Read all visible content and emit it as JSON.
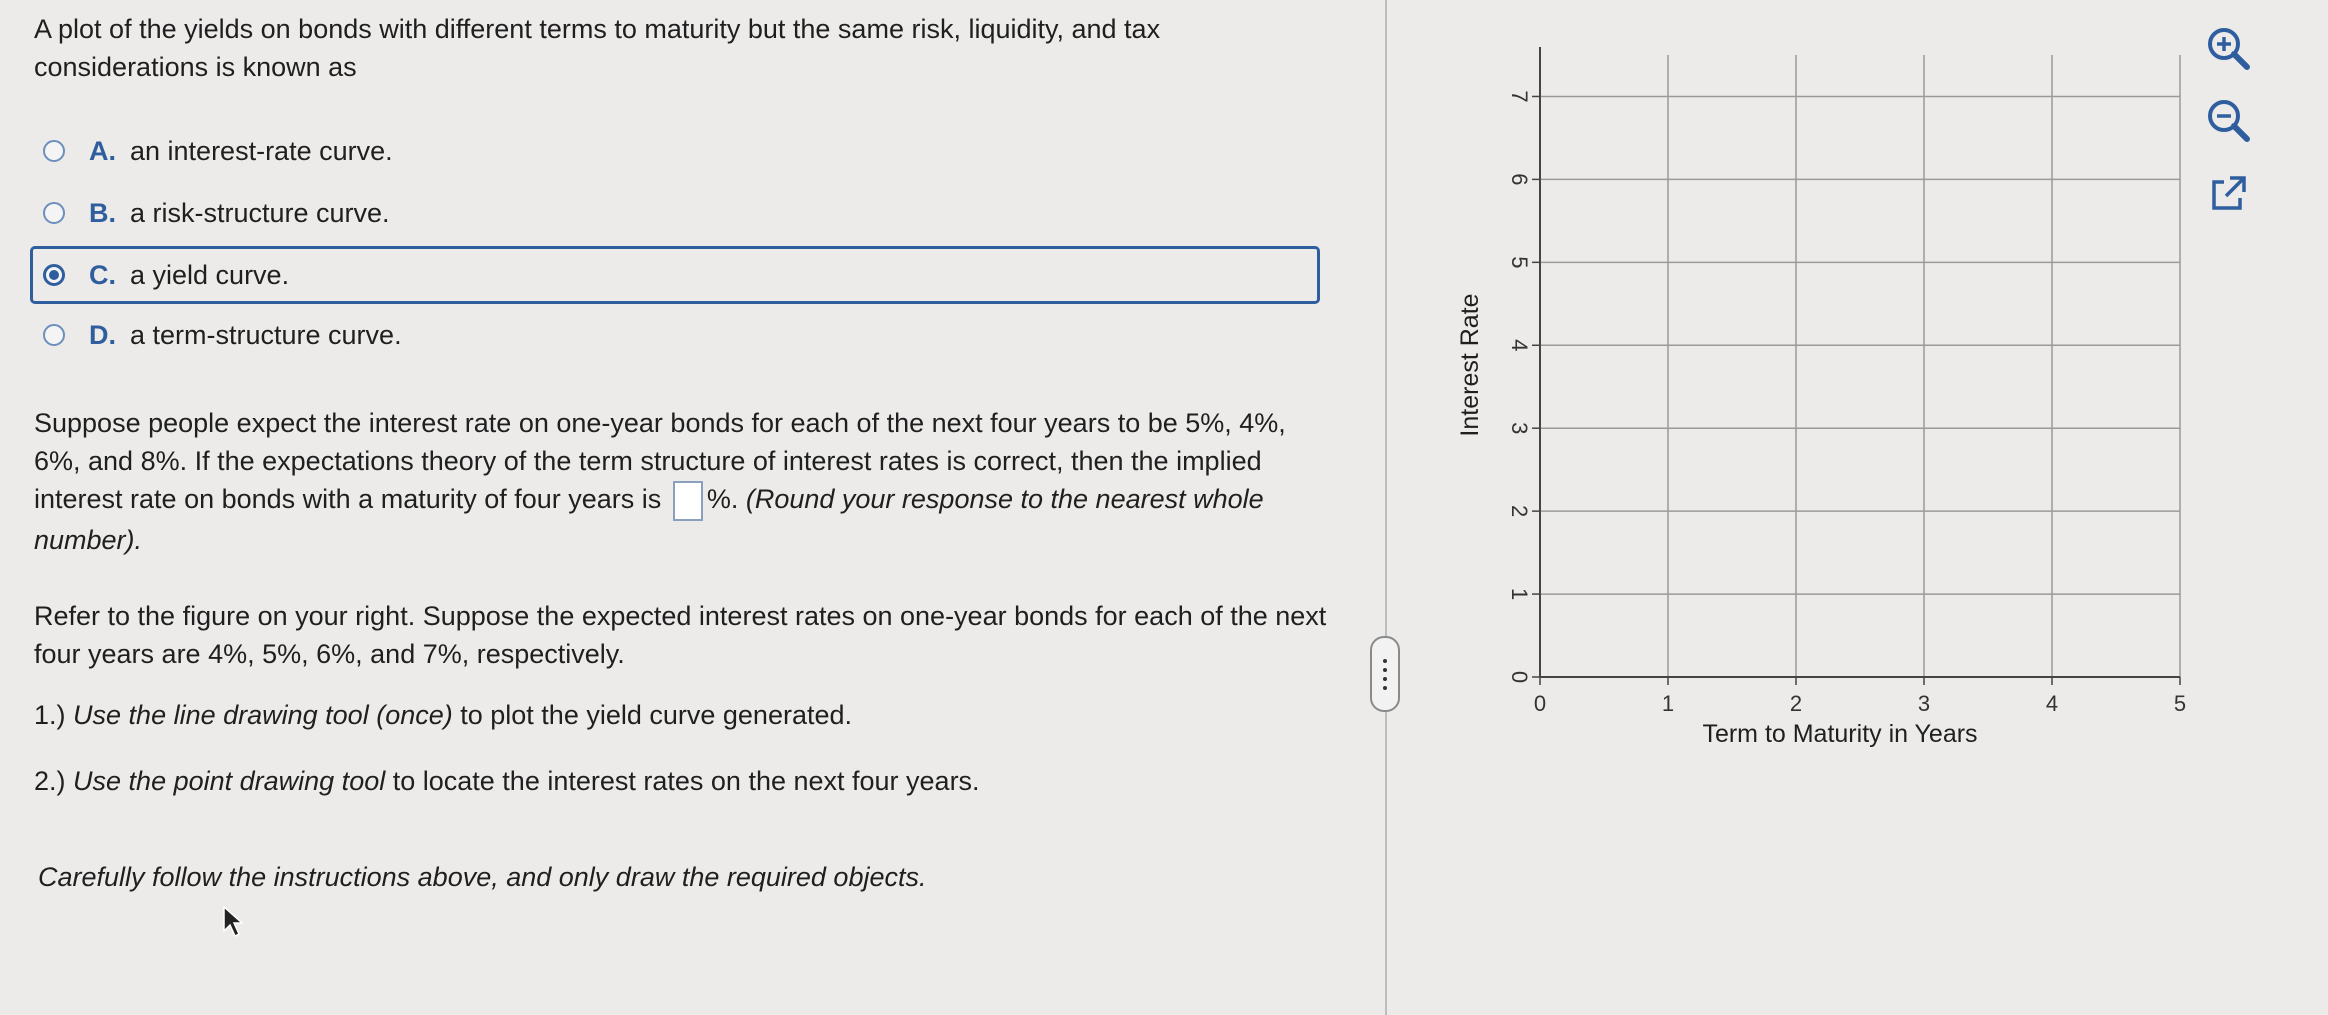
{
  "question1": {
    "prompt": "A plot of the yields on bonds with different terms to maturity but the same risk, liquidity, and tax considerations is known as",
    "options": [
      {
        "letter": "A.",
        "text": "an interest-rate curve."
      },
      {
        "letter": "B.",
        "text": "a risk-structure curve."
      },
      {
        "letter": "C.",
        "text": "a yield curve."
      },
      {
        "letter": "D.",
        "text": "a term-structure curve."
      }
    ],
    "selected": "C."
  },
  "question2": {
    "part1": "Suppose people expect the interest rate on one-year bonds for each of the next four years to be 5%, 4%, 6%, and 8%. If the expectations theory of the term structure of interest rates is correct, then the implied interest rate on bonds with a maturity of four years is",
    "answer_value": "",
    "part2": "%.",
    "part3": "(Round your response to the nearest whole number)."
  },
  "question3": {
    "prompt": "Refer to the figure on your right. Suppose the expected interest rates on one-year bonds for each of the next four years are 4%, 5%, 6%, and 7%, respectively.",
    "instruction1_num": "1.)",
    "instruction1_italic": "Use the line drawing tool (once)",
    "instruction1_rest": "to plot the yield curve generated.",
    "instruction2_num": "2.)",
    "instruction2_italic": "Use the point drawing tool",
    "instruction2_rest": "to locate the interest rates on the next four years.",
    "careful": "Carefully follow the instructions above, and only draw the required objects."
  },
  "chart_data": {
    "type": "line",
    "xlabel": "Term to Maturity in Years",
    "ylabel": "Interest Rate",
    "xlim": [
      0,
      5
    ],
    "ylim": [
      0,
      7.5
    ],
    "x_ticks": [
      "0",
      "1",
      "2",
      "3",
      "4",
      "5"
    ],
    "y_ticks": [
      "0",
      "1",
      "2",
      "3",
      "4",
      "5",
      "6",
      "7"
    ],
    "grid": true,
    "series": []
  },
  "tools": {
    "zoom_in": "zoom-in-icon",
    "zoom_out": "zoom-out-icon",
    "popout": "external-link-icon"
  },
  "colors": {
    "accent": "#2f5e9e",
    "grid": "#9a9a9a"
  }
}
